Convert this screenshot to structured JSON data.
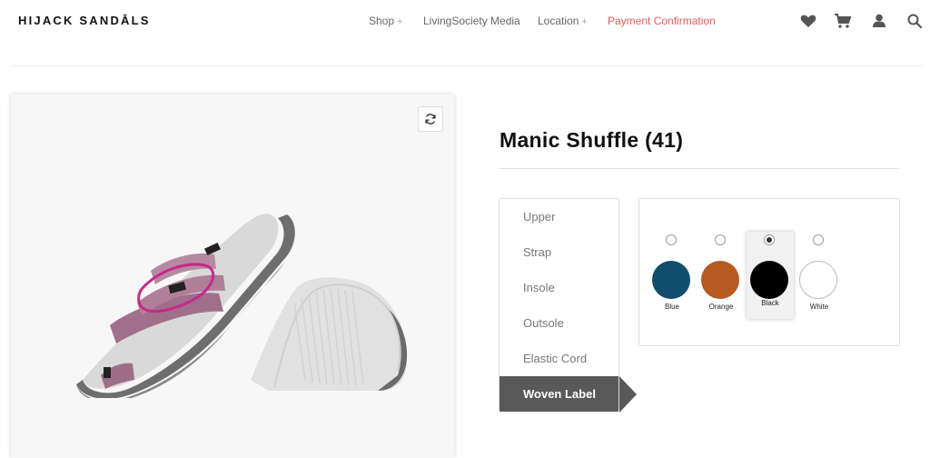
{
  "header": {
    "logo": "HIJACK SANDĀLS",
    "nav": [
      {
        "label": "Shop",
        "has_plus": true,
        "active": false
      },
      {
        "label": "LivingSociety Media",
        "has_plus": false,
        "active": false
      },
      {
        "label": "Location",
        "has_plus": true,
        "active": false
      },
      {
        "label": "Payment Confirmation",
        "has_plus": false,
        "active": true
      }
    ],
    "plus_symbol": "+",
    "icons": [
      "heart-icon",
      "cart-icon",
      "user-icon",
      "search-icon"
    ]
  },
  "preview": {
    "rotate_icon": "rotate-icon",
    "image": "sandal-product-image"
  },
  "product": {
    "title": "Manic Shuffle (41)"
  },
  "parts": [
    {
      "label": "Upper",
      "active": false
    },
    {
      "label": "Strap",
      "active": false
    },
    {
      "label": "Insole",
      "active": false
    },
    {
      "label": "Outsole",
      "active": false
    },
    {
      "label": "Elastic Cord",
      "active": false
    },
    {
      "label": "Woven Label",
      "active": true
    }
  ],
  "swatches": [
    {
      "name": "Blue",
      "color": "#114e6e",
      "selected": false
    },
    {
      "name": "Orange",
      "color": "#b65a22",
      "selected": false
    },
    {
      "name": "Black",
      "color": "#000000",
      "selected": true
    },
    {
      "name": "White",
      "color": "#ffffff",
      "selected": false
    }
  ],
  "colors": {
    "accent_active_nav": "#e85a5a",
    "active_part_bg": "#595959"
  }
}
